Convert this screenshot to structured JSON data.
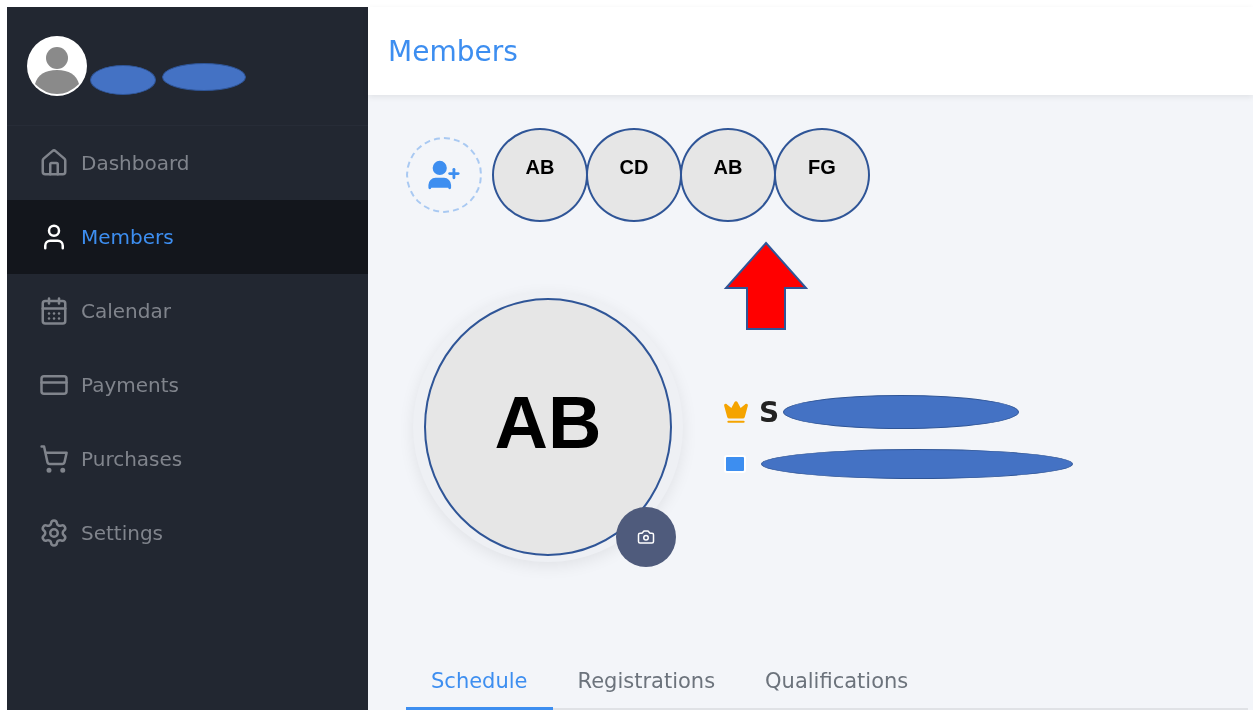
{
  "sidebar": {
    "items": [
      {
        "label": "Dashboard",
        "selected": false
      },
      {
        "label": "Members",
        "selected": true
      },
      {
        "label": "Calendar",
        "selected": false
      },
      {
        "label": "Payments",
        "selected": false
      },
      {
        "label": "Purchases",
        "selected": false
      },
      {
        "label": "Settings",
        "selected": false
      }
    ]
  },
  "header": {
    "title": "Members"
  },
  "members": [
    {
      "initials": "AB"
    },
    {
      "initials": "CD"
    },
    {
      "initials": "AB"
    },
    {
      "initials": "FG"
    }
  ],
  "profile": {
    "initials": "AB",
    "name": "S"
  },
  "tabs": [
    {
      "label": "Schedule",
      "selected": true
    },
    {
      "label": "Registrations",
      "selected": false
    },
    {
      "label": "Qualifications",
      "selected": false
    }
  ]
}
